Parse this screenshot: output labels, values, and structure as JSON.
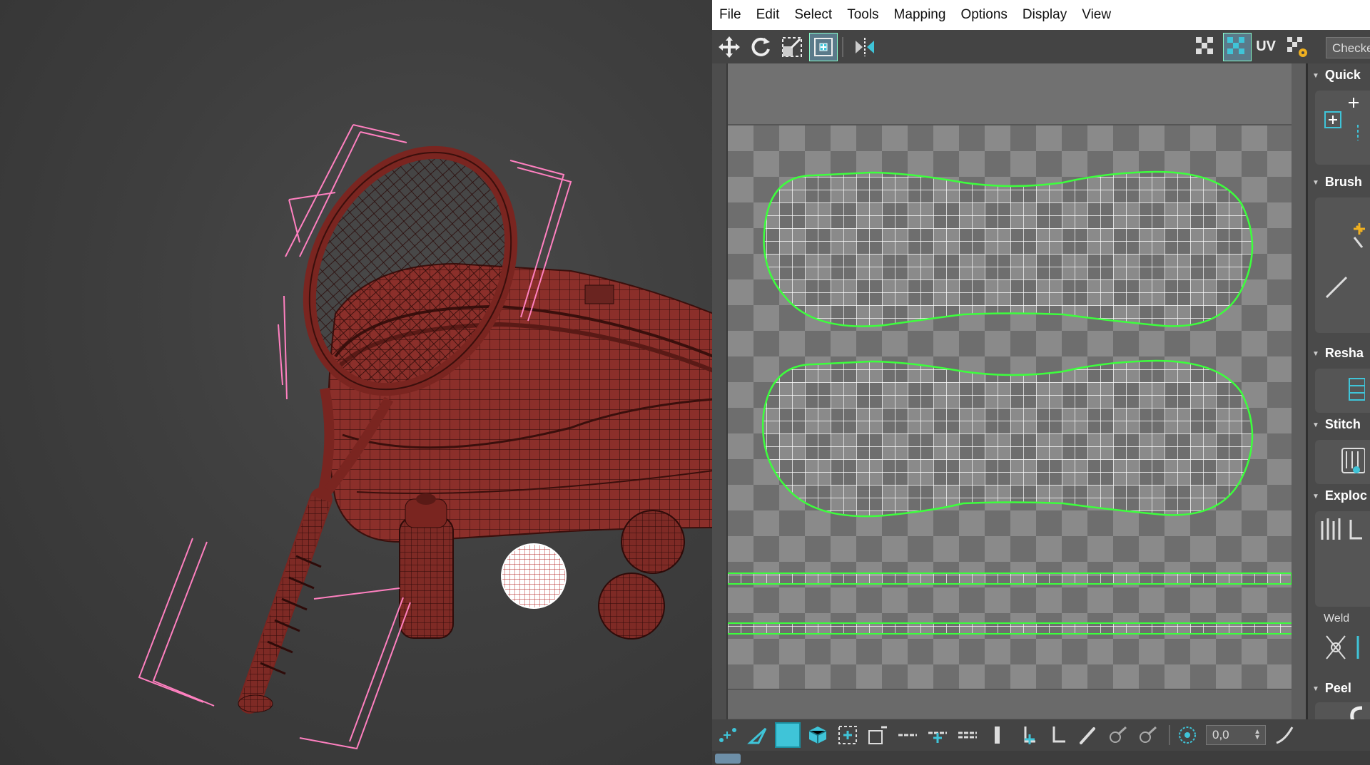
{
  "menubar": {
    "items": [
      "File",
      "Edit",
      "Select",
      "Tools",
      "Mapping",
      "Options",
      "Display",
      "View"
    ]
  },
  "toolbar_top": {
    "tools": [
      "move-icon",
      "rotate-icon",
      "scale-icon",
      "freeform-icon",
      "mirror-icon"
    ],
    "right_tools": [
      "checker-pattern-icon",
      "checker-toggle-icon"
    ],
    "uv_label": "UV",
    "checker_dropdown": "Checke"
  },
  "right_panel": {
    "rollouts": [
      "Quick",
      "Brush",
      "Resha",
      "Stitch",
      "Exploc",
      "Peel"
    ],
    "weld_label": "Weld",
    "peel_check_label": "D"
  },
  "toolbar_bottom": {
    "tools": [
      "vertex-select-icon",
      "edge-select-icon",
      "face-select-icon",
      "element-select-icon",
      "grow-icon",
      "shrink-icon",
      "loop-icon",
      "ring-icon",
      "ring2-icon",
      "ring3-icon",
      "weld-icon",
      "break-icon",
      "paint-select-icon",
      "brush-icon",
      "brush2-icon",
      "soft-select-icon"
    ],
    "spinner_value": "0,0"
  },
  "colors": {
    "mesh": "#8b2f2a",
    "wire": "#3a0f0c",
    "selection": "#ff80c0",
    "uv_edge": "#ffffff",
    "uv_border": "#3dff3d",
    "accent": "#3fc4d8"
  }
}
